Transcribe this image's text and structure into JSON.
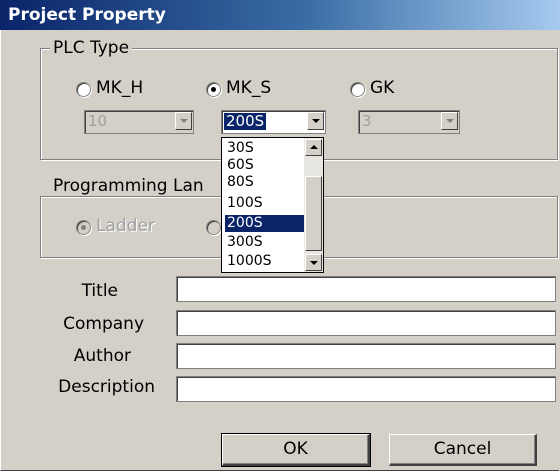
{
  "window": {
    "title": "Project Property"
  },
  "plc_type": {
    "group_label": "PLC Type",
    "options": [
      {
        "label": "MK_H",
        "checked": false,
        "model_value": "10"
      },
      {
        "label": "MK_S",
        "checked": true,
        "model_value": "200S"
      },
      {
        "label": "GK",
        "checked": false,
        "model_value": "3"
      }
    ],
    "dropdown_items": [
      "30S",
      "60S",
      "80S",
      "100S",
      "200S",
      "300S",
      "1000S"
    ],
    "dropdown_selected": "200S"
  },
  "programming_language": {
    "group_label_visible": "Programming Lan",
    "options": [
      {
        "label": "Ladder",
        "checked": true,
        "disabled": true
      },
      {
        "label": "",
        "checked": false,
        "disabled": true
      }
    ]
  },
  "fields": [
    {
      "label": "Title",
      "value": ""
    },
    {
      "label": "Company",
      "value": ""
    },
    {
      "label": "Author",
      "value": ""
    },
    {
      "label": "Description",
      "value": ""
    }
  ],
  "buttons": {
    "ok": "OK",
    "cancel": "Cancel"
  }
}
